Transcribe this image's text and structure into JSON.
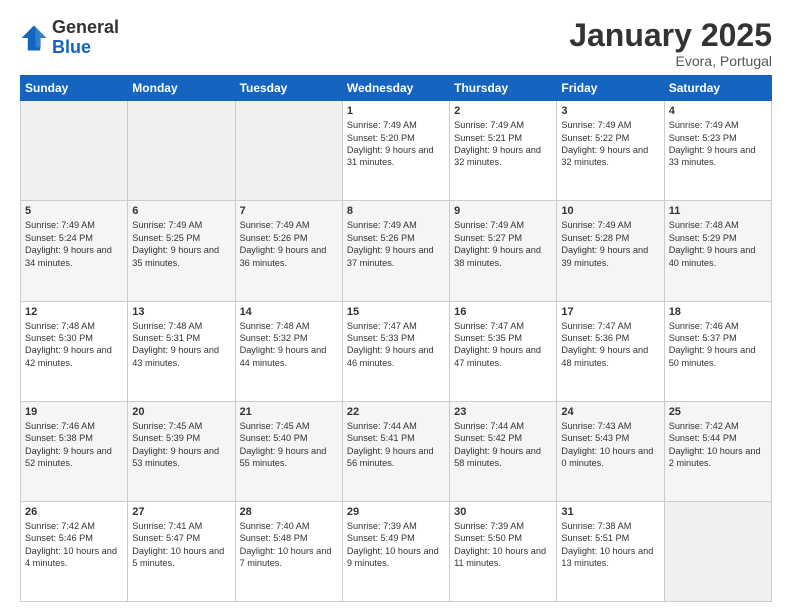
{
  "header": {
    "logo_general": "General",
    "logo_blue": "Blue",
    "month_title": "January 2025",
    "location": "Evora, Portugal"
  },
  "days_of_week": [
    "Sunday",
    "Monday",
    "Tuesday",
    "Wednesday",
    "Thursday",
    "Friday",
    "Saturday"
  ],
  "weeks": [
    [
      {
        "day": "",
        "content": ""
      },
      {
        "day": "",
        "content": ""
      },
      {
        "day": "",
        "content": ""
      },
      {
        "day": "1",
        "content": "Sunrise: 7:49 AM\nSunset: 5:20 PM\nDaylight: 9 hours\nand 31 minutes."
      },
      {
        "day": "2",
        "content": "Sunrise: 7:49 AM\nSunset: 5:21 PM\nDaylight: 9 hours\nand 32 minutes."
      },
      {
        "day": "3",
        "content": "Sunrise: 7:49 AM\nSunset: 5:22 PM\nDaylight: 9 hours\nand 32 minutes."
      },
      {
        "day": "4",
        "content": "Sunrise: 7:49 AM\nSunset: 5:23 PM\nDaylight: 9 hours\nand 33 minutes."
      }
    ],
    [
      {
        "day": "5",
        "content": "Sunrise: 7:49 AM\nSunset: 5:24 PM\nDaylight: 9 hours\nand 34 minutes."
      },
      {
        "day": "6",
        "content": "Sunrise: 7:49 AM\nSunset: 5:25 PM\nDaylight: 9 hours\nand 35 minutes."
      },
      {
        "day": "7",
        "content": "Sunrise: 7:49 AM\nSunset: 5:26 PM\nDaylight: 9 hours\nand 36 minutes."
      },
      {
        "day": "8",
        "content": "Sunrise: 7:49 AM\nSunset: 5:26 PM\nDaylight: 9 hours\nand 37 minutes."
      },
      {
        "day": "9",
        "content": "Sunrise: 7:49 AM\nSunset: 5:27 PM\nDaylight: 9 hours\nand 38 minutes."
      },
      {
        "day": "10",
        "content": "Sunrise: 7:49 AM\nSunset: 5:28 PM\nDaylight: 9 hours\nand 39 minutes."
      },
      {
        "day": "11",
        "content": "Sunrise: 7:48 AM\nSunset: 5:29 PM\nDaylight: 9 hours\nand 40 minutes."
      }
    ],
    [
      {
        "day": "12",
        "content": "Sunrise: 7:48 AM\nSunset: 5:30 PM\nDaylight: 9 hours\nand 42 minutes."
      },
      {
        "day": "13",
        "content": "Sunrise: 7:48 AM\nSunset: 5:31 PM\nDaylight: 9 hours\nand 43 minutes."
      },
      {
        "day": "14",
        "content": "Sunrise: 7:48 AM\nSunset: 5:32 PM\nDaylight: 9 hours\nand 44 minutes."
      },
      {
        "day": "15",
        "content": "Sunrise: 7:47 AM\nSunset: 5:33 PM\nDaylight: 9 hours\nand 46 minutes."
      },
      {
        "day": "16",
        "content": "Sunrise: 7:47 AM\nSunset: 5:35 PM\nDaylight: 9 hours\nand 47 minutes."
      },
      {
        "day": "17",
        "content": "Sunrise: 7:47 AM\nSunset: 5:36 PM\nDaylight: 9 hours\nand 48 minutes."
      },
      {
        "day": "18",
        "content": "Sunrise: 7:46 AM\nSunset: 5:37 PM\nDaylight: 9 hours\nand 50 minutes."
      }
    ],
    [
      {
        "day": "19",
        "content": "Sunrise: 7:46 AM\nSunset: 5:38 PM\nDaylight: 9 hours\nand 52 minutes."
      },
      {
        "day": "20",
        "content": "Sunrise: 7:45 AM\nSunset: 5:39 PM\nDaylight: 9 hours\nand 53 minutes."
      },
      {
        "day": "21",
        "content": "Sunrise: 7:45 AM\nSunset: 5:40 PM\nDaylight: 9 hours\nand 55 minutes."
      },
      {
        "day": "22",
        "content": "Sunrise: 7:44 AM\nSunset: 5:41 PM\nDaylight: 9 hours\nand 56 minutes."
      },
      {
        "day": "23",
        "content": "Sunrise: 7:44 AM\nSunset: 5:42 PM\nDaylight: 9 hours\nand 58 minutes."
      },
      {
        "day": "24",
        "content": "Sunrise: 7:43 AM\nSunset: 5:43 PM\nDaylight: 10 hours\nand 0 minutes."
      },
      {
        "day": "25",
        "content": "Sunrise: 7:42 AM\nSunset: 5:44 PM\nDaylight: 10 hours\nand 2 minutes."
      }
    ],
    [
      {
        "day": "26",
        "content": "Sunrise: 7:42 AM\nSunset: 5:46 PM\nDaylight: 10 hours\nand 4 minutes."
      },
      {
        "day": "27",
        "content": "Sunrise: 7:41 AM\nSunset: 5:47 PM\nDaylight: 10 hours\nand 5 minutes."
      },
      {
        "day": "28",
        "content": "Sunrise: 7:40 AM\nSunset: 5:48 PM\nDaylight: 10 hours\nand 7 minutes."
      },
      {
        "day": "29",
        "content": "Sunrise: 7:39 AM\nSunset: 5:49 PM\nDaylight: 10 hours\nand 9 minutes."
      },
      {
        "day": "30",
        "content": "Sunrise: 7:39 AM\nSunset: 5:50 PM\nDaylight: 10 hours\nand 11 minutes."
      },
      {
        "day": "31",
        "content": "Sunrise: 7:38 AM\nSunset: 5:51 PM\nDaylight: 10 hours\nand 13 minutes."
      },
      {
        "day": "",
        "content": ""
      }
    ]
  ]
}
